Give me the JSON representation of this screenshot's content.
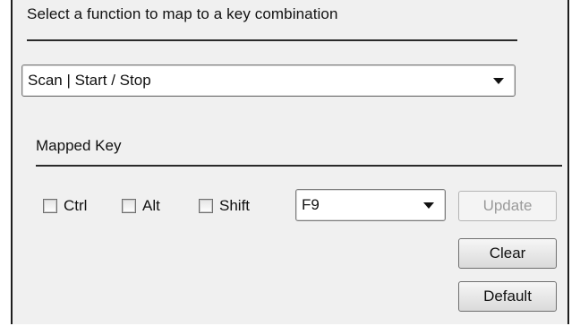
{
  "heading": "Select a function to map to a key combination",
  "function_select": {
    "value": "Scan | Start / Stop"
  },
  "mapped_key": {
    "label": "Mapped Key",
    "modifiers": [
      {
        "label": "Ctrl",
        "checked": false
      },
      {
        "label": "Alt",
        "checked": false
      },
      {
        "label": "Shift",
        "checked": false
      }
    ],
    "key_select": {
      "value": "F9"
    }
  },
  "buttons": {
    "update": {
      "label": "Update",
      "enabled": false
    },
    "clear": {
      "label": "Clear",
      "enabled": true
    },
    "default": {
      "label": "Default",
      "enabled": true
    }
  },
  "icons": {
    "dropdown": "chevron-down-icon"
  }
}
